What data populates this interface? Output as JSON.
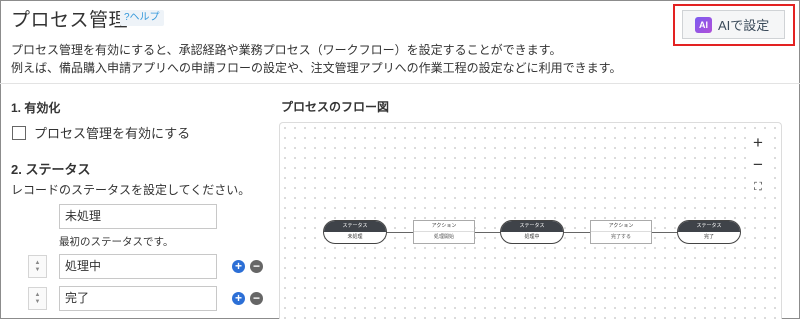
{
  "header": {
    "title": "プロセス管理",
    "help_label": "?ヘルプ",
    "ai_button_icon_text": "AI",
    "ai_button_label": "AIで設定"
  },
  "description": {
    "line1": "プロセス管理を有効にすると、承認経路や業務プロセス（ワークフロー）を設定することができます。",
    "line2": "例えば、備品購入申請アプリへの申請フローの設定や、注文管理アプリへの作業工程の設定などに利用できます。"
  },
  "enable": {
    "heading": "1. 有効化",
    "checkbox_label": "プロセス管理を有効にする",
    "checked": false
  },
  "status": {
    "heading": "2. ステータス",
    "description": "レコードのステータスを設定してください。",
    "first_value": "未処理",
    "first_note": "最初のステータスです。",
    "rows": [
      {
        "value": "処理中"
      },
      {
        "value": "完了"
      }
    ]
  },
  "flow": {
    "heading": "プロセスのフロー図",
    "zoom_in": "+",
    "zoom_out": "−",
    "fit": "⛶",
    "nodes": [
      {
        "header": "ステータス",
        "label": "未処理"
      },
      {
        "header": "ステータス",
        "label": "処理中"
      },
      {
        "header": "ステータス",
        "label": "完了"
      }
    ],
    "actions": [
      {
        "header": "アクション",
        "label": "処理開始"
      },
      {
        "header": "アクション",
        "label": "完了する"
      }
    ]
  },
  "colors": {
    "accent_blue": "#2c6fd6",
    "highlight_red": "#e32222",
    "ai_gradient": "#7b5cf0"
  }
}
